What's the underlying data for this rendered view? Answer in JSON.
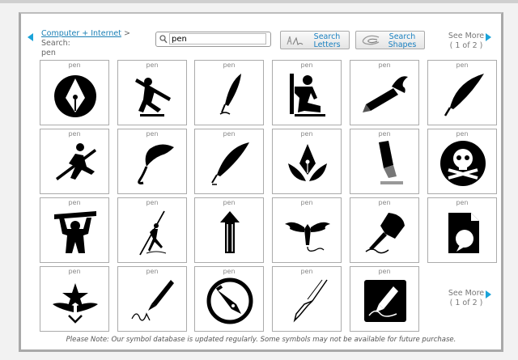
{
  "breadcrumb": {
    "link": "Computer + Internet",
    "sep": " > ",
    "label": "Search:",
    "term": "pen"
  },
  "search": {
    "value": "pen",
    "placeholder": ""
  },
  "buttons": {
    "letters": "Search Letters",
    "shapes": "Search Shapes"
  },
  "paging": {
    "see_more": "See More",
    "page": "( 1 of 2 )"
  },
  "symbols": [
    {
      "caption": "pen",
      "icon": "fountain-pen-nib-circle-icon"
    },
    {
      "caption": "pen",
      "icon": "man-carrying-pen-icon"
    },
    {
      "caption": "pen",
      "icon": "quill-writing-icon"
    },
    {
      "caption": "pen",
      "icon": "kneeling-man-pencil-icon"
    },
    {
      "caption": "pen",
      "icon": "winged-pencil-icon"
    },
    {
      "caption": "pen",
      "icon": "feather-quill-icon"
    },
    {
      "caption": "pen",
      "icon": "running-man-pen-icon"
    },
    {
      "caption": "pen",
      "icon": "curled-quill-icon"
    },
    {
      "caption": "pen",
      "icon": "feather-icon"
    },
    {
      "caption": "pen",
      "icon": "nib-with-leaves-icon"
    },
    {
      "caption": "pen",
      "icon": "marker-pen-icon"
    },
    {
      "caption": "pen",
      "icon": "skull-crossbones-circle-icon"
    },
    {
      "caption": "pen",
      "icon": "strongman-lifting-pencil-icon"
    },
    {
      "caption": "pen",
      "icon": "javelin-thrower-icon"
    },
    {
      "caption": "pen",
      "icon": "pencil-upward-arrow-icon"
    },
    {
      "caption": "pen",
      "icon": "winged-pen-icon"
    },
    {
      "caption": "pen",
      "icon": "hand-writing-icon"
    },
    {
      "caption": "pen",
      "icon": "document-speech-bubble-icon"
    },
    {
      "caption": "pen",
      "icon": "winged-star-emblem-icon"
    },
    {
      "caption": "pen",
      "icon": "pen-signature-icon"
    },
    {
      "caption": "pen",
      "icon": "fountain-pen-circle-icon"
    },
    {
      "caption": "pen",
      "icon": "fountain-pen-outline-icon"
    },
    {
      "caption": "pen",
      "icon": "pen-signing-box-icon"
    }
  ],
  "note": "Please Note: Our symbol database is updated regularly. Some symbols may not be available for future purchase.",
  "colors": {
    "accent": "#1aa3d9",
    "link": "#1a7fb5",
    "border": "#a9a9a9"
  }
}
